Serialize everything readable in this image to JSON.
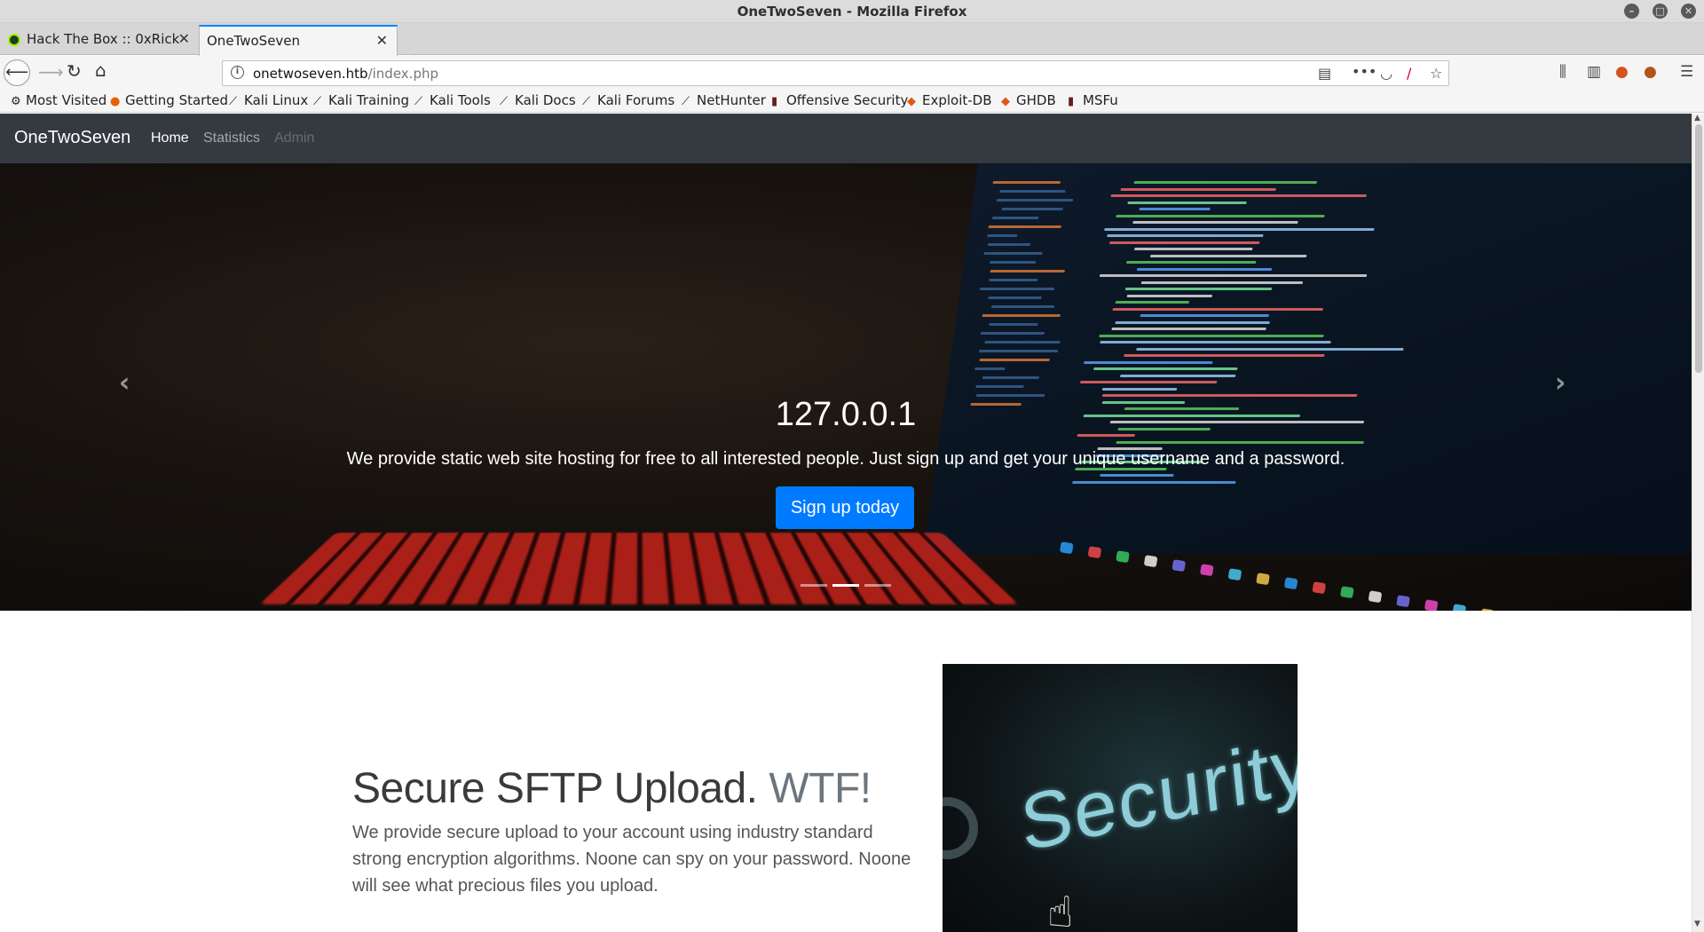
{
  "window": {
    "title": "OneTwoSeven - Mozilla Firefox"
  },
  "tabs": [
    {
      "label": "Hack The Box :: 0xRick",
      "active": false
    },
    {
      "label": "OneTwoSeven",
      "active": true
    }
  ],
  "address": {
    "host": "onetwoseven.htb",
    "path": "/index.php"
  },
  "bookmarks": [
    {
      "label": "Most Visited",
      "icon": "gear-icon"
    },
    {
      "label": "Getting Started",
      "icon": "firefox-icon"
    },
    {
      "label": "Kali Linux",
      "icon": "kali-dragon-icon"
    },
    {
      "label": "Kali Training",
      "icon": "kali-dragon-icon"
    },
    {
      "label": "Kali Tools",
      "icon": "kali-dragon-icon"
    },
    {
      "label": "Kali Docs",
      "icon": "kali-dragon-icon"
    },
    {
      "label": "Kali Forums",
      "icon": "kali-dragon-icon"
    },
    {
      "label": "NetHunter",
      "icon": "kali-dragon-icon"
    },
    {
      "label": "Offensive Security",
      "icon": "offsec-icon"
    },
    {
      "label": "Exploit-DB",
      "icon": "exploitdb-icon"
    },
    {
      "label": "GHDB",
      "icon": "exploitdb-icon"
    },
    {
      "label": "MSFu",
      "icon": "offsec-icon"
    }
  ],
  "site": {
    "brand": "OneTwoSeven",
    "nav": [
      {
        "label": "Home",
        "state": "active"
      },
      {
        "label": "Statistics",
        "state": "normal"
      },
      {
        "label": "Admin",
        "state": "disabled"
      }
    ],
    "carousel": {
      "title": "127.0.0.1",
      "text": "We provide static web site hosting for free to all interested people. Just sign up and get your unique username and a password.",
      "button": "Sign up today",
      "slide_count": 3,
      "active_slide": 2
    },
    "feature": {
      "heading": "Secure SFTP Upload.",
      "heading_muted": "WTF!",
      "text": "We provide secure upload to your account using industry standard strong encryption algorithms. Noone can spy on your password. Noone will see what precious files you upload.",
      "image_text": "Security"
    }
  },
  "colors": {
    "accent": "#0a84ff",
    "site_nav": "#343a40",
    "primary_button": "#007bff"
  }
}
